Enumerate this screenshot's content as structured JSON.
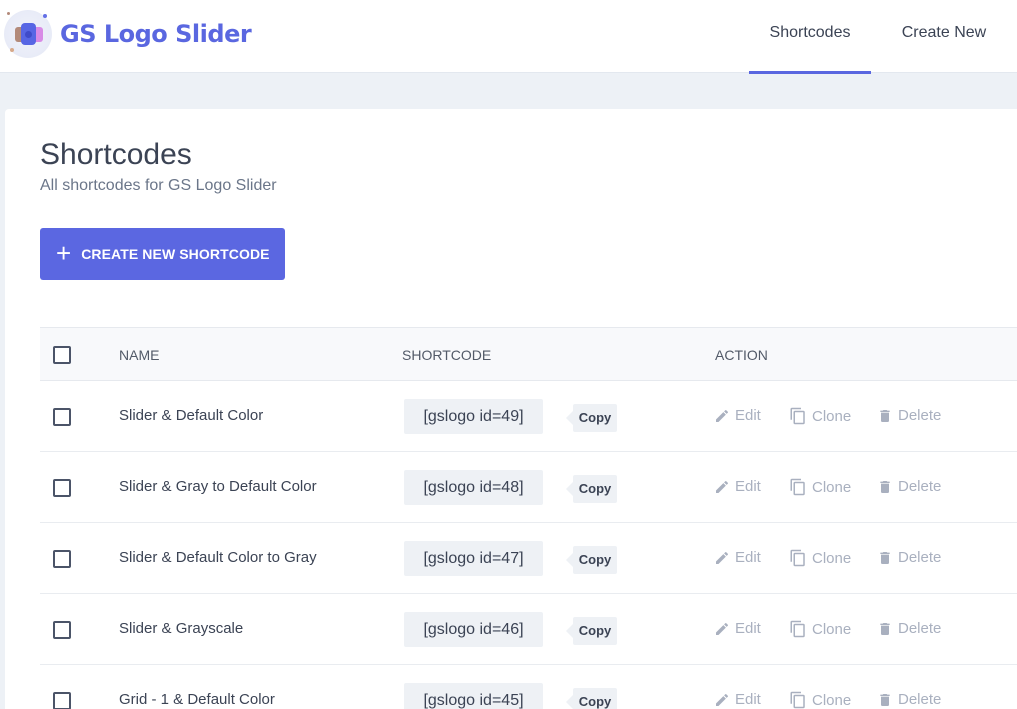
{
  "header": {
    "brand": "GS Logo Slider",
    "nav": [
      {
        "label": "Shortcodes",
        "active": true
      },
      {
        "label": "Create New",
        "active": false
      }
    ],
    "accent_color": "#5a67e0"
  },
  "page": {
    "title": "Shortcodes",
    "subtitle": "All shortcodes for GS Logo Slider",
    "create_button": {
      "icon": "plus-icon",
      "label": "CREATE NEW SHORTCODE"
    }
  },
  "table": {
    "columns": [
      "NAME",
      "SHORTCODE",
      "ACTION"
    ],
    "actions": {
      "edit": "Edit",
      "clone": "Clone",
      "delete": "Delete"
    },
    "copy_label": "Copy",
    "rows": [
      {
        "name": "Slider & Default Color",
        "shortcode": "[gslogo id=49]"
      },
      {
        "name": "Slider & Gray to Default Color",
        "shortcode": "[gslogo id=48]"
      },
      {
        "name": "Slider & Default Color to Gray",
        "shortcode": "[gslogo id=47]"
      },
      {
        "name": "Slider & Grayscale",
        "shortcode": "[gslogo id=46]"
      },
      {
        "name": "Grid - 1 & Default Color",
        "shortcode": "[gslogo id=45]"
      }
    ]
  }
}
